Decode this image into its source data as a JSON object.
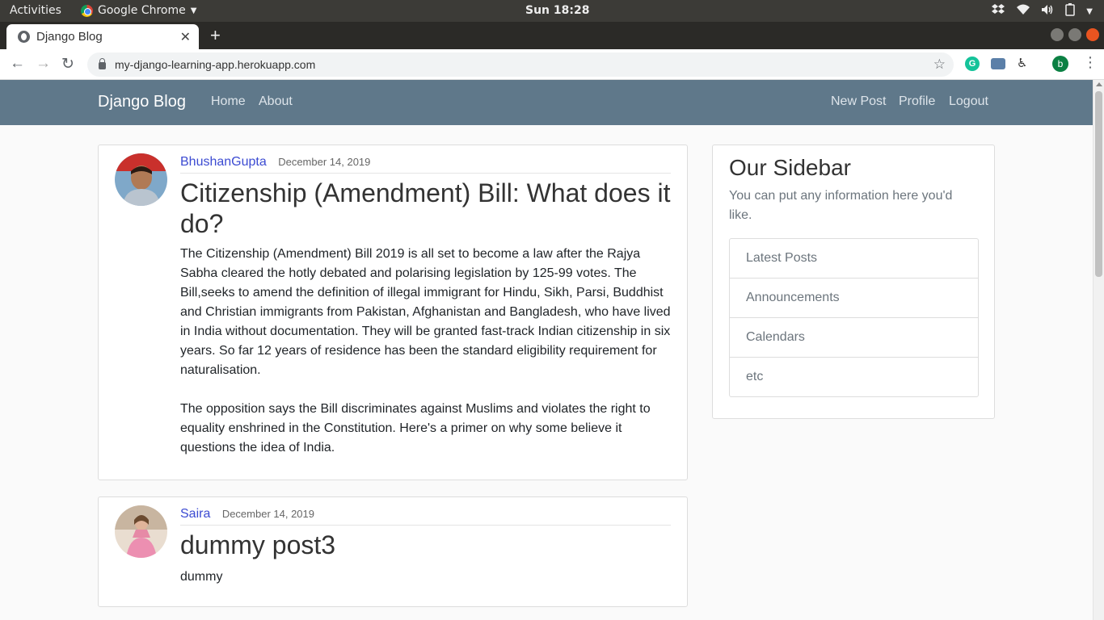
{
  "os": {
    "activities": "Activities",
    "app_name": "Google Chrome",
    "clock": "Sun 18:28"
  },
  "browser": {
    "tab_title": "Django Blog",
    "url": "my-django-learning-app.herokuapp.com",
    "profile_initial": "b",
    "grammarly_letter": "G"
  },
  "navbar": {
    "brand": "Django Blog",
    "home": "Home",
    "about": "About",
    "new_post": "New Post",
    "profile": "Profile",
    "logout": "Logout",
    "background": "#5f788a"
  },
  "posts": [
    {
      "author": "BhushanGupta",
      "date": "December 14, 2019",
      "title": "Citizenship (Amendment) Bill: What does it do?",
      "body_p1": "The Citizenship (Amendment) Bill 2019 is all set to become a law after the Rajya Sabha cleared the hotly debated and polarising legislation by 125-99 votes. The Bill,seeks to amend the definition of illegal immigrant for Hindu, Sikh, Parsi, Buddhist and Christian immigrants from Pakistan, Afghanistan and Bangladesh, who have lived in India without documentation. They will be granted fast-track Indian citizenship in six years. So far 12 years of residence has been the standard eligibility requirement for naturalisation.",
      "body_p2": "The opposition says the Bill discriminates against Muslims and violates the right to equality enshrined in the Constitution. Here's a primer on why some believe it questions the idea of India."
    },
    {
      "author": "Saira",
      "date": "December 14, 2019",
      "title": "dummy post3",
      "body_p1": "dummy"
    }
  ],
  "sidebar": {
    "title": "Our Sidebar",
    "description": "You can put any information here you'd like.",
    "items": [
      "Latest Posts",
      "Announcements",
      "Calendars",
      "etc"
    ]
  }
}
